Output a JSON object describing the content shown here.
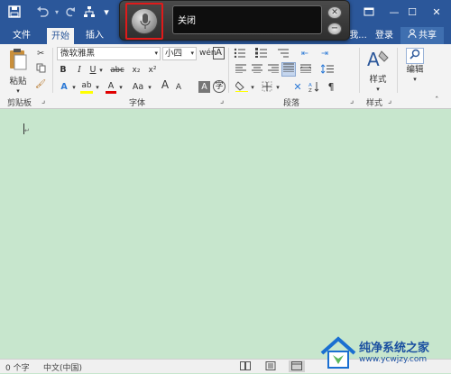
{
  "titlebar": {
    "save_icon": "save-icon",
    "undo_icon": "undo-icon",
    "redo_icon": "redo-icon",
    "connect_icon": "network-icon",
    "qat_more": "▾",
    "restore_icon": "restore-icon",
    "minimize": "—",
    "maximize": "☐",
    "close": "✕"
  },
  "tabs": {
    "file": "文件",
    "home": "开始",
    "insert": "插入",
    "hidden": "我...",
    "login": "登录",
    "share": "共享"
  },
  "voice": {
    "status_text": "关闭",
    "close_icon": "close-icon",
    "minimize_icon": "minimize-icon"
  },
  "clipboard": {
    "paste_label": "粘贴",
    "group_label": "剪贴板"
  },
  "font": {
    "font_name": "微软雅黑",
    "font_size": "小四",
    "bold": "B",
    "italic": "I",
    "underline": "U",
    "strike": "abc",
    "subscript": "x₂",
    "superscript": "x²",
    "highlight_letter": "ab",
    "color_letter": "A",
    "case": "Aa",
    "grow": "A",
    "shrink": "A",
    "clear": "A",
    "char_a": "A",
    "group_label": "字体"
  },
  "paragraph": {
    "group_label": "段落"
  },
  "styles": {
    "style_label": "样式",
    "group_label": "样式"
  },
  "editing": {
    "edit_label": "编辑"
  },
  "status": {
    "word_count": "0 个字",
    "language": "中文(中国)"
  },
  "watermark": {
    "title": "纯净系统之家",
    "url": "www.ycwjzy.com"
  },
  "colors": {
    "brand_blue": "#2b579a",
    "doc_green": "#c7e6cd",
    "highlight_yellow": "#ffff00",
    "font_red": "#e00000",
    "mic_border": "#e01a1a"
  }
}
